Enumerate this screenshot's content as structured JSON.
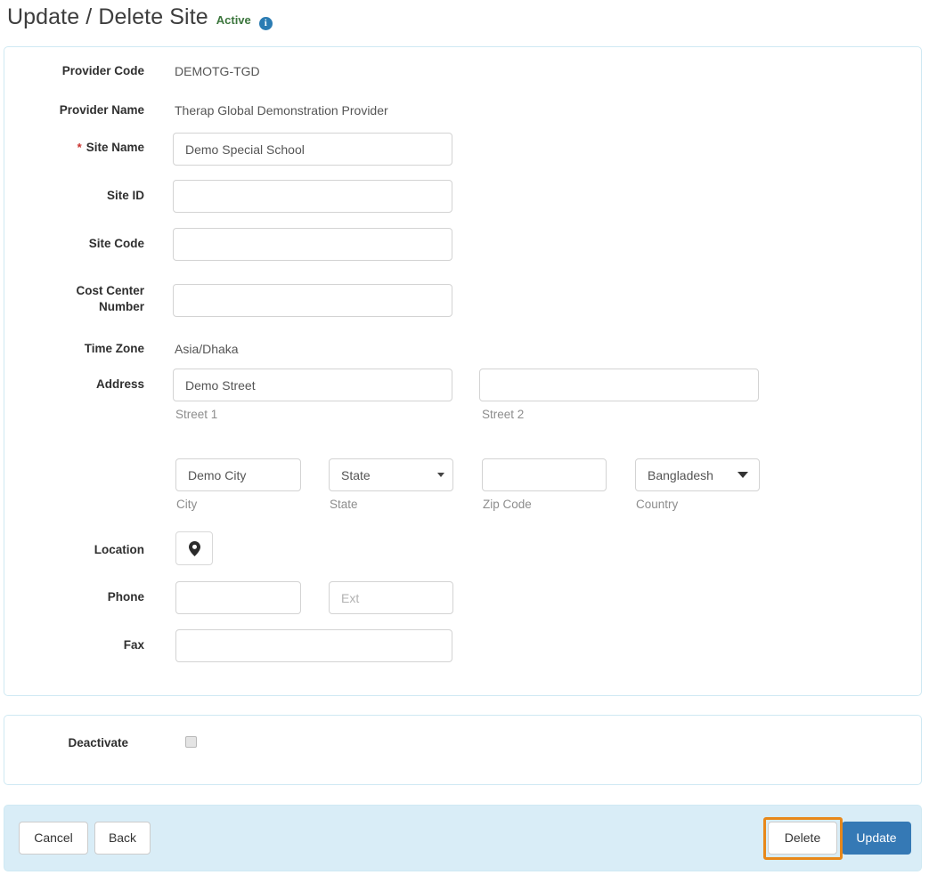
{
  "header": {
    "title": "Update / Delete Site",
    "status": "Active",
    "info_icon": "info-icon",
    "status_color": "#3c763d",
    "info_color": "#2b7cb3"
  },
  "form": {
    "provider_code": {
      "label": "Provider Code",
      "value": "DEMOTG-TGD"
    },
    "provider_name": {
      "label": "Provider Name",
      "value": "Therap Global Demonstration Provider"
    },
    "site_name": {
      "label": "Site Name",
      "required": "*",
      "value": "Demo Special School"
    },
    "site_id": {
      "label": "Site ID",
      "value": ""
    },
    "site_code": {
      "label": "Site Code",
      "value": ""
    },
    "cost_center": {
      "label_line1": "Cost Center",
      "label_line2": "Number",
      "value": ""
    },
    "time_zone": {
      "label": "Time Zone",
      "value": "Asia/Dhaka"
    },
    "address": {
      "label": "Address",
      "street1": {
        "value": "Demo Street",
        "caption": "Street 1"
      },
      "street2": {
        "value": "",
        "caption": "Street 2"
      },
      "city": {
        "value": "Demo City",
        "caption": "City"
      },
      "state": {
        "selected": "State",
        "caption": "State"
      },
      "zip": {
        "value": "",
        "caption": "Zip Code"
      },
      "country": {
        "selected": "Bangladesh",
        "caption": "Country"
      }
    },
    "location": {
      "label": "Location",
      "icon": "map-pin-icon"
    },
    "phone": {
      "label": "Phone",
      "value": "",
      "ext_placeholder": "Ext",
      "ext_value": ""
    },
    "fax": {
      "label": "Fax",
      "value": ""
    }
  },
  "deactivate": {
    "label": "Deactivate",
    "checked": false
  },
  "footer": {
    "cancel": "Cancel",
    "back": "Back",
    "delete": "Delete",
    "update": "Update",
    "primary_color": "#3579b5",
    "highlight_color": "#e8881a",
    "bar_color": "#d9edf7"
  }
}
